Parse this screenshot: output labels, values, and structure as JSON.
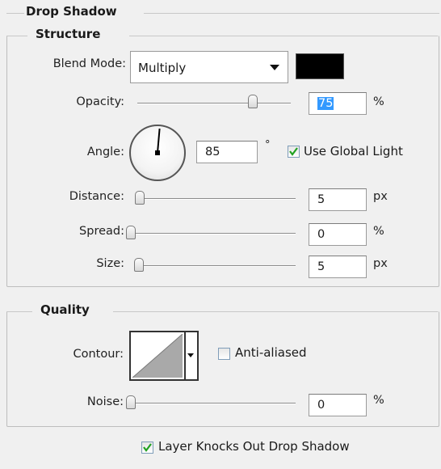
{
  "panel": {
    "title": "Drop Shadow"
  },
  "structure": {
    "legend": "Structure",
    "blend_mode": {
      "label": "Blend Mode:",
      "value": "Multiply",
      "shadow_color": "#000000"
    },
    "opacity": {
      "label": "Opacity:",
      "value": "75",
      "unit": "%",
      "level": 0.75
    },
    "angle": {
      "label": "Angle:",
      "value": "85",
      "unit": "°",
      "degrees": 85,
      "use_global_light": {
        "label": "Use Global Light",
        "checked": true
      }
    },
    "distance": {
      "label": "Distance:",
      "value": "5",
      "unit": "px",
      "level": 0.017
    },
    "spread": {
      "label": "Spread:",
      "value": "0",
      "unit": "%",
      "level": 0
    },
    "size": {
      "label": "Size:",
      "value": "5",
      "unit": "px",
      "level": 0.02
    }
  },
  "quality": {
    "legend": "Quality",
    "contour": {
      "label": "Contour:",
      "anti_aliased": {
        "label": "Anti-aliased",
        "checked": false
      }
    },
    "noise": {
      "label": "Noise:",
      "value": "0",
      "unit": "%",
      "level": 0
    }
  },
  "layer_knocks_out": {
    "label": "Layer Knocks Out Drop Shadow",
    "checked": true
  }
}
